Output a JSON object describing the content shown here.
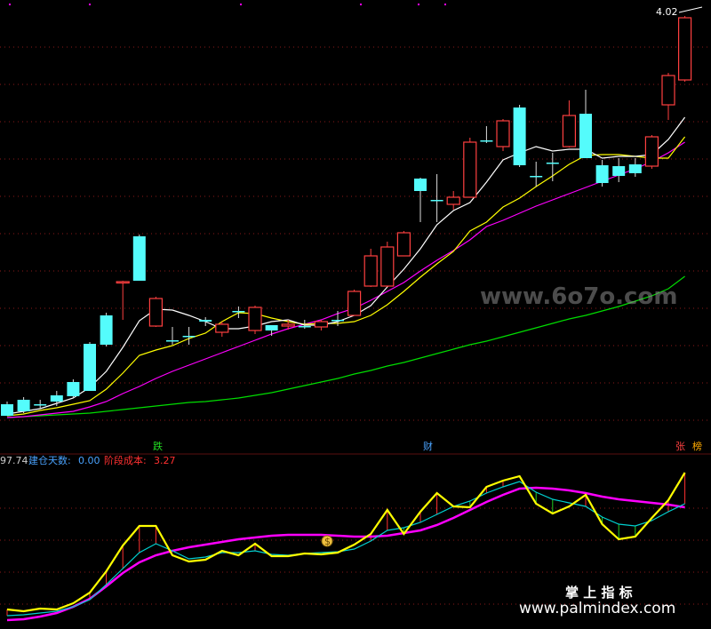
{
  "main_panel": {
    "last_price_label": "4.02",
    "markers": [
      {
        "text": "跌",
        "color": "#22dd22"
      },
      {
        "text": "财",
        "color": "#4aa3ff"
      },
      {
        "text": "张",
        "color": "#ff4040"
      },
      {
        "text": "榜",
        "color": "#ffaa00"
      }
    ]
  },
  "indicator_panel": {
    "header_prefix": "97.74",
    "field1_label": "建仓天数:",
    "field1_value": "0.00",
    "field2_label": "阶段成本:",
    "field2_value": "3.27",
    "moneybag_glyph": "$"
  },
  "watermarks": {
    "top": "www.6o7o.com",
    "brand": "掌 上 指 标",
    "url": "www.palmindex.com"
  },
  "colors": {
    "up": "#ff4040",
    "down": "#54fcfc",
    "ma5": "#ffffff",
    "ma10": "#ffff00",
    "ma20": "#ff00ff",
    "ma60": "#00dd00",
    "ind_main": "#ffff00",
    "ind_signal": "#00d0d0",
    "ind_slow": "#ff00ff",
    "header_blue": "#4aa3ff",
    "header_red": "#ff3030"
  },
  "chart_data": [
    {
      "type": "candlestick",
      "candles": [
        [
          455,
          468,
          468,
          452
        ],
        [
          450,
          463,
          465,
          447
        ],
        [
          455,
          455,
          460,
          450
        ],
        [
          445,
          452,
          457,
          440
        ],
        [
          430,
          446,
          448,
          427
        ],
        [
          387,
          440,
          440,
          385
        ],
        [
          355,
          388,
          390,
          352
        ],
        [
          318,
          317,
          360,
          316
        ],
        [
          266,
          316,
          316,
          264
        ],
        [
          367,
          336,
          368,
          334
        ],
        [
          383,
          383,
          388,
          368
        ],
        [
          378,
          378,
          388,
          368
        ],
        [
          360,
          362,
          367,
          357
        ],
        [
          374,
          365,
          379,
          362
        ],
        [
          350,
          350,
          358,
          345
        ],
        [
          372,
          346,
          376,
          344
        ],
        [
          366,
          372,
          378,
          366
        ],
        [
          367,
          365,
          371,
          360
        ],
        [
          367,
          367,
          370,
          360
        ],
        [
          368,
          362,
          372,
          360
        ],
        [
          360,
          360,
          367,
          350
        ],
        [
          355,
          328,
          355,
          326
        ],
        [
          322,
          288,
          323,
          280
        ],
        [
          322,
          278,
          323,
          272
        ],
        [
          288,
          262,
          288,
          260
        ],
        [
          201,
          215,
          250,
          200
        ],
        [
          225,
          225,
          250,
          196
        ],
        [
          230,
          222,
          236,
          215
        ],
        [
          222,
          160,
          222,
          155
        ],
        [
          158,
          158,
          161,
          142
        ],
        [
          165,
          136,
          170,
          134
        ],
        [
          121,
          186,
          188,
          118
        ],
        [
          198,
          198,
          210,
          182
        ],
        [
          183,
          183,
          204,
          172
        ],
        [
          165,
          130,
          166,
          113
        ],
        [
          128,
          178,
          178,
          101
        ],
        [
          186,
          206,
          210,
          180
        ],
        [
          187,
          198,
          205,
          178
        ],
        [
          185,
          195,
          199,
          178
        ],
        [
          187,
          154,
          190,
          152
        ],
        [
          118,
          85,
          135,
          82
        ],
        [
          90,
          20,
          92,
          18
        ]
      ],
      "ma": {
        "ma5": [
          466,
          463,
          460,
          454,
          448,
          436,
          418,
          391,
          361,
          348,
          349,
          355,
          362,
          370,
          370,
          367,
          362,
          360,
          366,
          366,
          362,
          355,
          344,
          323,
          303,
          280,
          253,
          237,
          228,
          205,
          180,
          172,
          165,
          170,
          168,
          168,
          178,
          176,
          176,
          174,
          157,
          132
        ],
        "ma10": [
          468,
          466,
          462,
          459,
          455,
          451,
          438,
          420,
          400,
          394,
          389,
          381,
          375,
          362,
          352,
          353,
          358,
          362,
          365,
          364,
          364,
          362,
          355,
          343,
          328,
          312,
          297,
          283,
          260,
          250,
          233,
          223,
          210,
          198,
          185,
          175,
          174,
          174,
          176,
          178,
          178,
          154
        ],
        "ma20": [
          470,
          469,
          467,
          465,
          463,
          458,
          452,
          443,
          435,
          426,
          418,
          411,
          404,
          397,
          390,
          383,
          376,
          370,
          365,
          360,
          353,
          347,
          338,
          328,
          318,
          305,
          293,
          282,
          270,
          255,
          248,
          240,
          232,
          225,
          218,
          211,
          204,
          197,
          190,
          182,
          172,
          160
        ],
        "ma60": [
          470,
          469,
          468,
          467,
          466,
          465,
          463,
          461,
          459,
          457,
          455,
          453,
          452,
          450,
          448,
          445,
          442,
          438,
          434,
          430,
          426,
          421,
          417,
          412,
          408,
          403,
          398,
          393,
          388,
          384,
          379,
          374,
          369,
          364,
          359,
          355,
          350,
          345,
          339,
          333,
          325,
          311
        ]
      },
      "series": [
        {
          "name": "MA5",
          "color": "#ffffff"
        },
        {
          "name": "MA10",
          "color": "#ffff00"
        },
        {
          "name": "MA20",
          "color": "#ff00ff"
        },
        {
          "name": "MA60",
          "color": "#00dd00"
        }
      ],
      "x_range": [
        1,
        42
      ],
      "y_note": "price axis; top of panel ≈ 4.02"
    },
    {
      "type": "line",
      "series": [
        {
          "name": "main",
          "color": "#ffff00",
          "values": [
            686,
            688,
            685,
            686,
            679,
            667,
            643,
            614,
            592,
            592,
            625,
            632,
            630,
            620,
            625,
            612,
            626,
            626,
            623,
            624,
            622,
            613,
            601,
            574,
            601,
            576,
            555,
            570,
            571,
            548,
            541,
            536,
            567,
            578,
            570,
            557,
            590,
            607,
            604,
            583,
            563,
            532
          ]
        },
        {
          "name": "signal",
          "color": "#00d0d0",
          "values": [
            693,
            692,
            690,
            688,
            683,
            675,
            658,
            640,
            622,
            612,
            620,
            629,
            627,
            622,
            622,
            620,
            624,
            625,
            623,
            622,
            621,
            618,
            609,
            597,
            594,
            588,
            579,
            570,
            564,
            555,
            548,
            542,
            554,
            562,
            566,
            570,
            582,
            590,
            592,
            586,
            576,
            567
          ]
        },
        {
          "name": "slow",
          "color": "#ff00ff",
          "values": [
            698,
            697,
            694,
            690,
            683,
            674,
            660,
            645,
            633,
            625,
            620,
            616,
            613,
            610,
            607,
            605,
            603,
            602,
            602,
            602,
            603,
            604,
            604,
            603,
            600,
            597,
            591,
            583,
            574,
            565,
            557,
            550,
            549,
            550,
            552,
            555,
            559,
            562,
            564,
            566,
            568,
            571
          ]
        }
      ]
    }
  ]
}
